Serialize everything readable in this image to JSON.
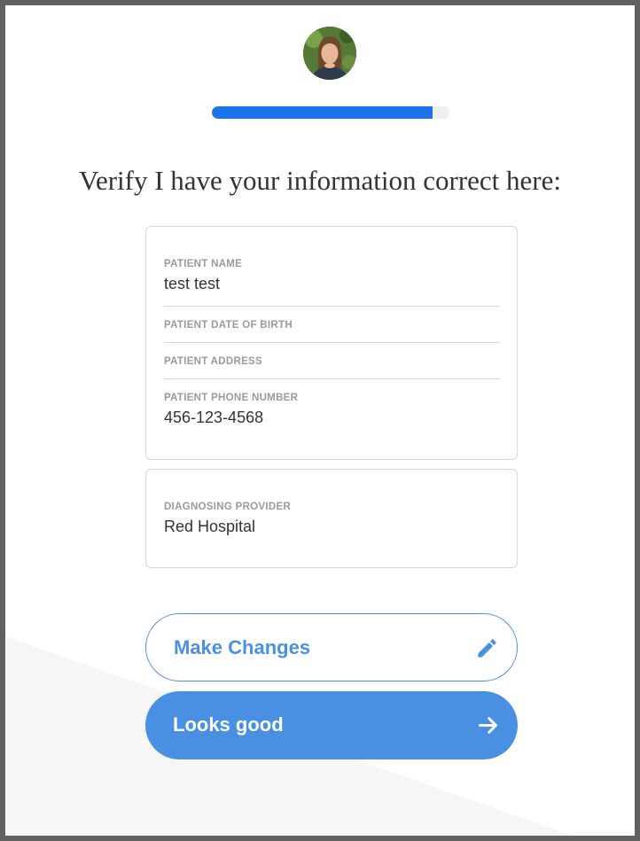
{
  "header": {
    "avatar_icon": "user-photo-avatar",
    "progress_fraction": 0.93,
    "accent_color": "#1a73e8"
  },
  "heading": "Verify I have your information correct here:",
  "patient_card": {
    "fields": [
      {
        "label": "PATIENT NAME",
        "value": "test test"
      },
      {
        "label": "PATIENT DATE OF BIRTH",
        "value": ""
      },
      {
        "label": "PATIENT ADDRESS",
        "value": ""
      },
      {
        "label": "PATIENT PHONE NUMBER",
        "value": "456-123-4568"
      }
    ]
  },
  "provider_card": {
    "label": "DIAGNOSING PROVIDER",
    "value": "Red Hospital"
  },
  "buttons": {
    "make_changes": {
      "label": "Make Changes",
      "icon": "pencil-icon",
      "color": "#4a90e2"
    },
    "looks_good": {
      "label": "Looks good",
      "icon": "arrow-right-icon",
      "color": "#4a90e2"
    }
  }
}
